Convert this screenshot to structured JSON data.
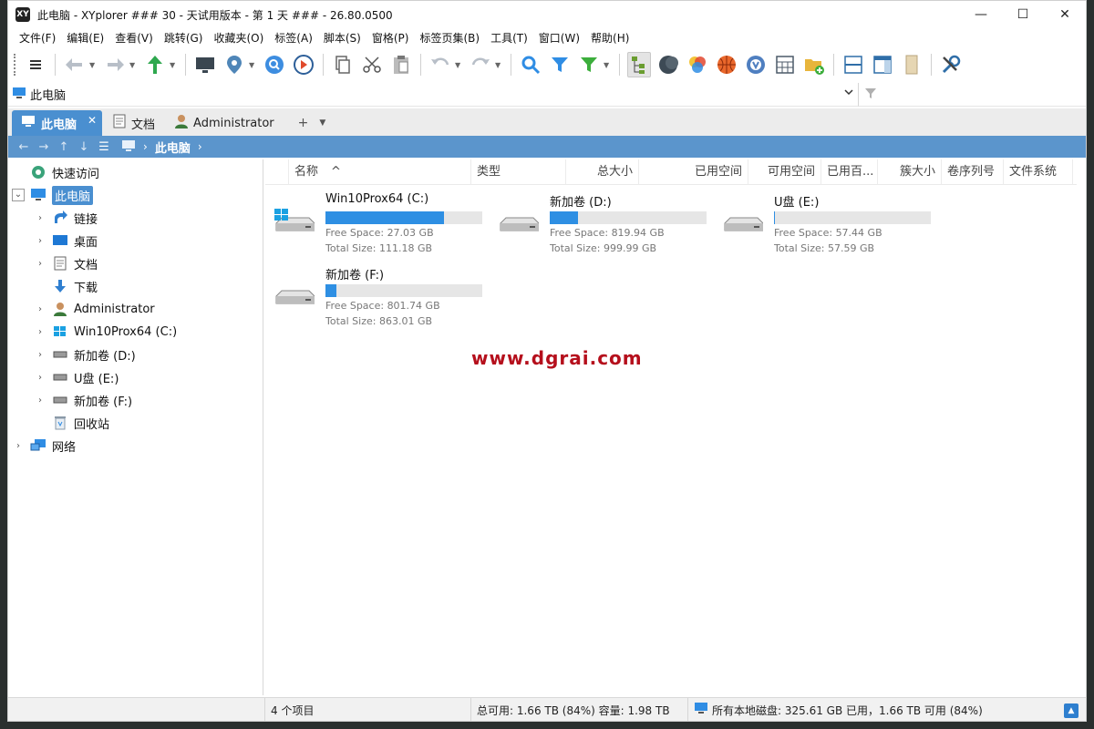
{
  "title": "此电脑 - XYplorer ### 30 - 天试用版本 - 第 1 天 ### - 26.80.0500",
  "app_icon_text": "XY",
  "window_buttons": {
    "minimize": "—",
    "maximize": "☐",
    "close": "✕"
  },
  "menu": [
    "文件(F)",
    "编辑(E)",
    "查看(V)",
    "跳转(G)",
    "收藏夹(O)",
    "标签(A)",
    "脚本(S)",
    "窗格(P)",
    "标签页集(B)",
    "工具(T)",
    "窗口(W)",
    "帮助(H)"
  ],
  "address": {
    "text": "此电脑"
  },
  "tabs": [
    {
      "label": "此电脑",
      "active": true
    },
    {
      "label": "文档",
      "active": false
    },
    {
      "label": "Administrator",
      "active": false
    }
  ],
  "tab_add": "+",
  "breadcrumb": {
    "current": "此电脑"
  },
  "tree": {
    "quick_access": "快速访问",
    "this_pc": "此电脑",
    "links": "链接",
    "desktop": "桌面",
    "documents": "文档",
    "downloads": "下载",
    "administrator": "Administrator",
    "drive_c": "Win10Prox64 (C:)",
    "drive_d": "新加卷 (D:)",
    "drive_e": "U盘 (E:)",
    "drive_f": "新加卷 (F:)",
    "recycle": "回收站",
    "network": "网络"
  },
  "columns": [
    "名称",
    "类型",
    "总大小",
    "已用空间",
    "可用空间",
    "已用百...",
    "簇大小",
    "卷序列号",
    "文件系统"
  ],
  "drives": [
    {
      "name": "Win10Prox64 (C:)",
      "free": "Free Space: 27.03 GB",
      "total": "Total Size: 111.18 GB",
      "used_fraction": 0.757
    },
    {
      "name": "新加卷 (D:)",
      "free": "Free Space: 819.94 GB",
      "total": "Total Size: 999.99 GB",
      "used_fraction": 0.18
    },
    {
      "name": "U盘 (E:)",
      "free": "Free Space: 57.44 GB",
      "total": "Total Size: 57.59 GB",
      "used_fraction": 0.003
    },
    {
      "name": "新加卷 (F:)",
      "free": "Free Space: 801.74 GB",
      "total": "Total Size: 863.01 GB",
      "used_fraction": 0.071
    }
  ],
  "watermark": "www.dgrai.com",
  "status": {
    "items": "4 个项目",
    "free": "总可用: 1.66 TB (84%)   容量: 1.98 TB",
    "disks": "所有本地磁盘: 325.61 GB 已用，1.66 TB 可用 (84%)"
  },
  "colors": {
    "accent": "#4a8fd0",
    "breadcrumb": "#5b95cc",
    "bar_fill": "#2e8fe3",
    "watermark": "#b50f1c"
  }
}
